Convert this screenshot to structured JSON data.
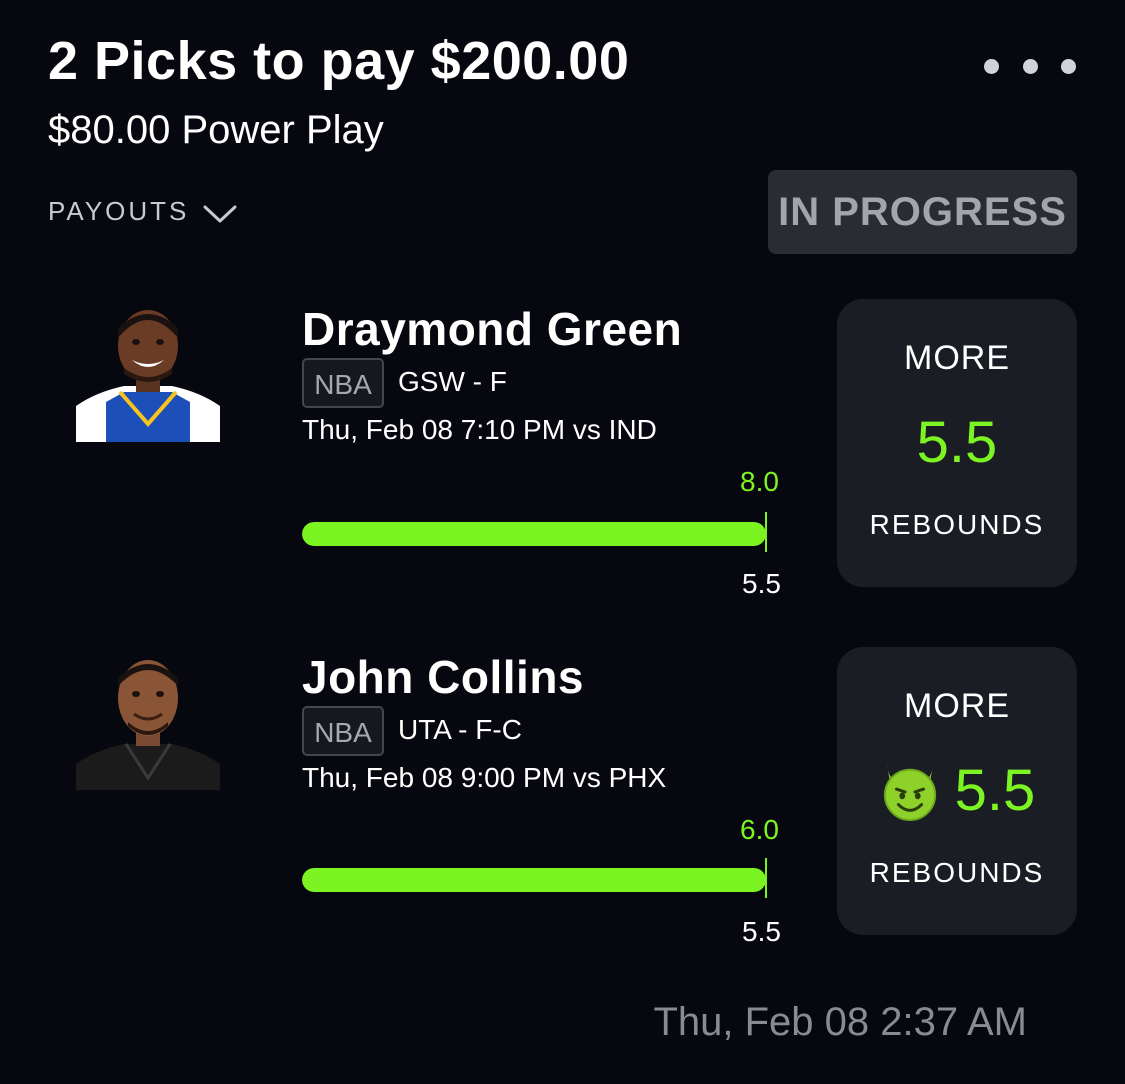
{
  "header": {
    "title": "2 Picks to pay $200.00",
    "subtitle": "$80.00 Power Play",
    "more_icon": "more-horizontal-icon"
  },
  "payouts": {
    "label": "PAYOUTS",
    "icon": "chevron-down-icon"
  },
  "status": {
    "label": "IN PROGRESS"
  },
  "picks": [
    {
      "player": "Draymond Green",
      "league": "NBA",
      "team_position": "GSW - F",
      "game": "Thu, Feb 08 7:10 PM  vs IND",
      "actual": "8.0",
      "line_label": "5.5",
      "progress": 1.0,
      "direction": "MORE",
      "line": "5.5",
      "stat": "REBOUNDS",
      "jersey_color": "#ffffff",
      "avatar_icon": "player-photo"
    },
    {
      "player": "John Collins",
      "league": "NBA",
      "team_position": "UTA - F-C",
      "game": "Thu, Feb 08 9:00 PM  vs PHX",
      "actual": "6.0",
      "line_label": "5.5",
      "progress": 1.0,
      "direction": "MORE",
      "line": "5.5",
      "stat": "REBOUNDS",
      "modifier_icon": "smiling-devil-icon",
      "jersey_color": "#1b1b1b",
      "avatar_icon": "player-photo"
    }
  ],
  "footer": {
    "timestamp": "Thu, Feb 08 2:37 AM"
  },
  "colors": {
    "background": "#07080f",
    "accent_green": "#7cf422",
    "card": "#1b1d24",
    "badge": "#2a2c33"
  }
}
